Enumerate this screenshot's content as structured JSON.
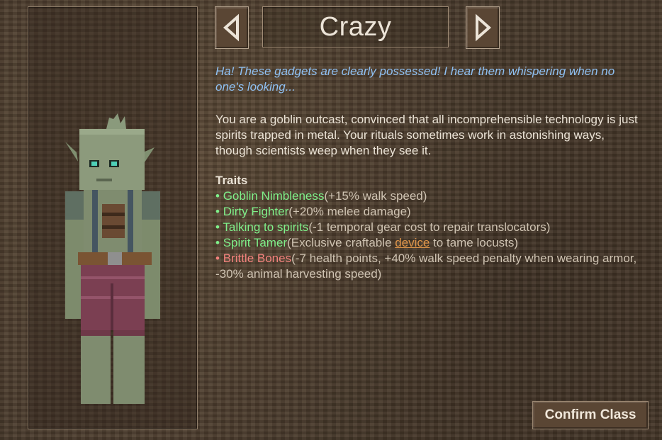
{
  "class_selector": {
    "class_name": "Crazy",
    "prev_icon": "left-arrow-icon",
    "next_icon": "right-arrow-icon"
  },
  "quote": "Ha! These gadgets are clearly possessed! I hear them whispering when no one's looking...",
  "description": "You are a goblin outcast, convinced that all incomprehensible technology is just spirits trapped in metal. Your rituals sometimes work in astonishing ways, though scientists weep when they see it.",
  "traits": {
    "title": "Traits",
    "items": [
      {
        "bullet": "•",
        "name": "Goblin Nimbleness",
        "desc": "(+15% walk speed)",
        "kind": "positive"
      },
      {
        "bullet": "•",
        "name": "Dirty Fighter",
        "desc": "(+20% melee damage)",
        "kind": "positive"
      },
      {
        "bullet": "•",
        "name": "Talking to spirits",
        "desc": "(-1 temporal gear cost to repair translocators)",
        "kind": "positive"
      },
      {
        "bullet": "•",
        "name": "Spirit Tamer",
        "desc_before": "(Exclusive craftable ",
        "link": "device",
        "desc_after": " to tame locusts)",
        "kind": "positive"
      },
      {
        "bullet": "•",
        "name": "Brittle Bones",
        "desc": "(-7 health points, +40% walk speed penalty when wearing armor, -30% animal harvesting speed)",
        "kind": "negative"
      }
    ]
  },
  "confirm_button": {
    "label": "Confirm Class"
  },
  "colors": {
    "quote": "#8fc0f2",
    "positive_trait": "#7ff08a",
    "negative_trait": "#f3827d",
    "link": "#e0964a"
  }
}
